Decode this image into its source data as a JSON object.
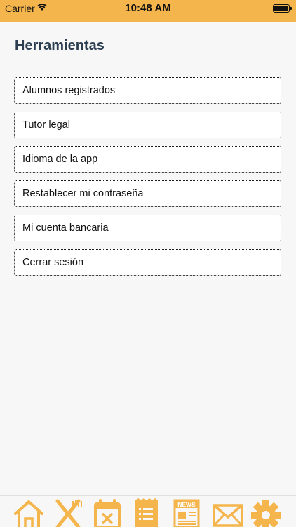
{
  "status_bar": {
    "carrier": "Carrier",
    "time": "10:48 AM",
    "wifi_icon": "wifi-icon",
    "battery_icon": "battery-icon"
  },
  "page": {
    "title": "Herramientas"
  },
  "menu": {
    "items": [
      {
        "label": "Alumnos registrados"
      },
      {
        "label": "Tutor legal"
      },
      {
        "label": "Idioma de la app"
      },
      {
        "label": "Restablecer mi contraseña"
      },
      {
        "label": "Mi cuenta bancaria"
      },
      {
        "label": "Cerrar sesión"
      }
    ]
  },
  "tab_bar": {
    "icons": [
      "home-icon",
      "utensils-icon",
      "calendar-absence-icon",
      "receipt-icon",
      "news-icon",
      "mail-icon",
      "gear-icon"
    ],
    "news_label": "NEWS"
  },
  "colors": {
    "accent": "#f5b54d",
    "title": "#2c3e50",
    "background": "#f7f7f7"
  }
}
